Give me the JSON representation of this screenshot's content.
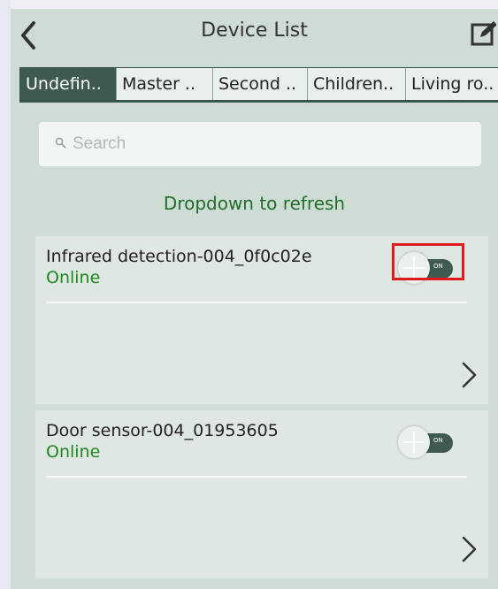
{
  "header": {
    "title": "Device List",
    "back_icon": "chevron-left-icon",
    "edit_icon": "edit-icon"
  },
  "tabs": [
    {
      "label": "Undefin..",
      "active": true
    },
    {
      "label": "Master ..",
      "active": false
    },
    {
      "label": "Second ..",
      "active": false
    },
    {
      "label": "Children..",
      "active": false
    },
    {
      "label": "Living ro..",
      "active": false
    }
  ],
  "search": {
    "placeholder": "Search",
    "icon": "search-icon"
  },
  "refresh_text": "Dropdown to refresh",
  "devices": [
    {
      "name": "Infrared detection-004_0f0c02e",
      "status": "Online",
      "toggle": "ON",
      "toggle_on": true,
      "highlighted": true
    },
    {
      "name": "Door sensor-004_01953605",
      "status": "Online",
      "toggle": "ON",
      "toggle_on": true,
      "highlighted": false
    }
  ],
  "colors": {
    "accent": "#3e5a50",
    "online": "#1e8a20",
    "refresh": "#1f6f2b",
    "highlight": "#e01a1a",
    "background": "#cfdcd6"
  }
}
